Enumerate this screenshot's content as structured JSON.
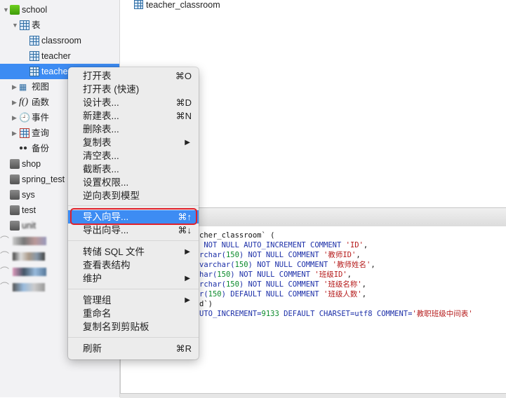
{
  "sidebar": {
    "database": "school",
    "tables_group": "表",
    "tables": [
      "classroom",
      "teacher",
      "teacher_classroom"
    ],
    "selected_table_visible": "teache",
    "groups": [
      "视图",
      "函数",
      "事件",
      "查询",
      "备份"
    ],
    "other_databases": [
      "shop",
      "spring_test",
      "sys",
      "test",
      "unit"
    ],
    "blurred_connections": 4
  },
  "main": {
    "objects": [
      {
        "name": "teacher_classroom",
        "icon": "table-icon"
      }
    ]
  },
  "ddl": {
    "lines": [
      [
        {
          "t": "cher_classroom` (",
          "c": ""
        }
      ],
      [
        {
          "t": " NOT NULL AUTO_INCREMENT COMMENT ",
          "c": "kw"
        },
        {
          "t": "'ID'",
          "c": "str"
        },
        {
          "t": ",",
          "c": ""
        }
      ],
      [
        {
          "t": "rchar(",
          "c": "kw"
        },
        {
          "t": "150",
          "c": "num"
        },
        {
          "t": ") NOT NULL COMMENT ",
          "c": "kw"
        },
        {
          "t": "'教师ID'",
          "c": "str"
        },
        {
          "t": ",",
          "c": ""
        }
      ],
      [
        {
          "t": "varchar(",
          "c": "kw"
        },
        {
          "t": "150",
          "c": "num"
        },
        {
          "t": ") NOT NULL COMMENT ",
          "c": "kw"
        },
        {
          "t": "'教师姓名'",
          "c": "str"
        },
        {
          "t": ",",
          "c": ""
        }
      ],
      [
        {
          "t": "har(",
          "c": "kw"
        },
        {
          "t": "150",
          "c": "num"
        },
        {
          "t": ") NOT NULL COMMENT ",
          "c": "kw"
        },
        {
          "t": "'班级ID'",
          "c": "str"
        },
        {
          "t": ",",
          "c": ""
        }
      ],
      [
        {
          "t": "rchar(",
          "c": "kw"
        },
        {
          "t": "150",
          "c": "num"
        },
        {
          "t": ") NOT NULL COMMENT ",
          "c": "kw"
        },
        {
          "t": "'班级名称'",
          "c": "str"
        },
        {
          "t": ",",
          "c": ""
        }
      ],
      [
        {
          "t": "r(",
          "c": "kw"
        },
        {
          "t": "150",
          "c": "num"
        },
        {
          "t": ") DEFAULT NULL COMMENT ",
          "c": "kw"
        },
        {
          "t": "'班级人数'",
          "c": "str"
        },
        {
          "t": ",",
          "c": ""
        }
      ],
      [
        {
          "t": "d`)",
          "c": ""
        }
      ],
      [
        {
          "t": "UTO_INCREMENT=",
          "c": "kw"
        },
        {
          "t": "9133",
          "c": "num"
        },
        {
          "t": " DEFAULT CHARSET=utf8 COMMENT=",
          "c": "kw"
        },
        {
          "t": "'教职班级中间表'",
          "c": "str"
        }
      ]
    ]
  },
  "context_menu": {
    "items": [
      {
        "label": "打开表",
        "shortcut": "⌘O"
      },
      {
        "label": "打开表 (快速)",
        "shortcut": ""
      },
      {
        "label": "设计表...",
        "shortcut": "⌘D"
      },
      {
        "label": "新建表...",
        "shortcut": "⌘N"
      },
      {
        "label": "删除表...",
        "shortcut": ""
      },
      {
        "label": "复制表",
        "submenu": true
      },
      {
        "label": "清空表...",
        "shortcut": ""
      },
      {
        "label": "截断表...",
        "shortcut": ""
      },
      {
        "label": "设置权限...",
        "shortcut": ""
      },
      {
        "label": "逆向表到模型",
        "shortcut": ""
      },
      {
        "label": "导入向导...",
        "shortcut": "⌘↑",
        "highlighted": true
      },
      {
        "label": "导出向导...",
        "shortcut": "⌘↓"
      },
      {
        "label": "转储 SQL 文件",
        "submenu": true
      },
      {
        "label": "查看表结构",
        "shortcut": ""
      },
      {
        "label": "维护",
        "submenu": true
      },
      {
        "label": "管理组",
        "submenu": true
      },
      {
        "label": "重命名",
        "shortcut": ""
      },
      {
        "label": "复制名到剪贴板",
        "shortcut": ""
      },
      {
        "label": "刷新",
        "shortcut": "⌘R"
      }
    ],
    "submenu_glyph": "▶",
    "highlight_color": "#3d8cf3",
    "annotation_color": "#e0202a"
  }
}
